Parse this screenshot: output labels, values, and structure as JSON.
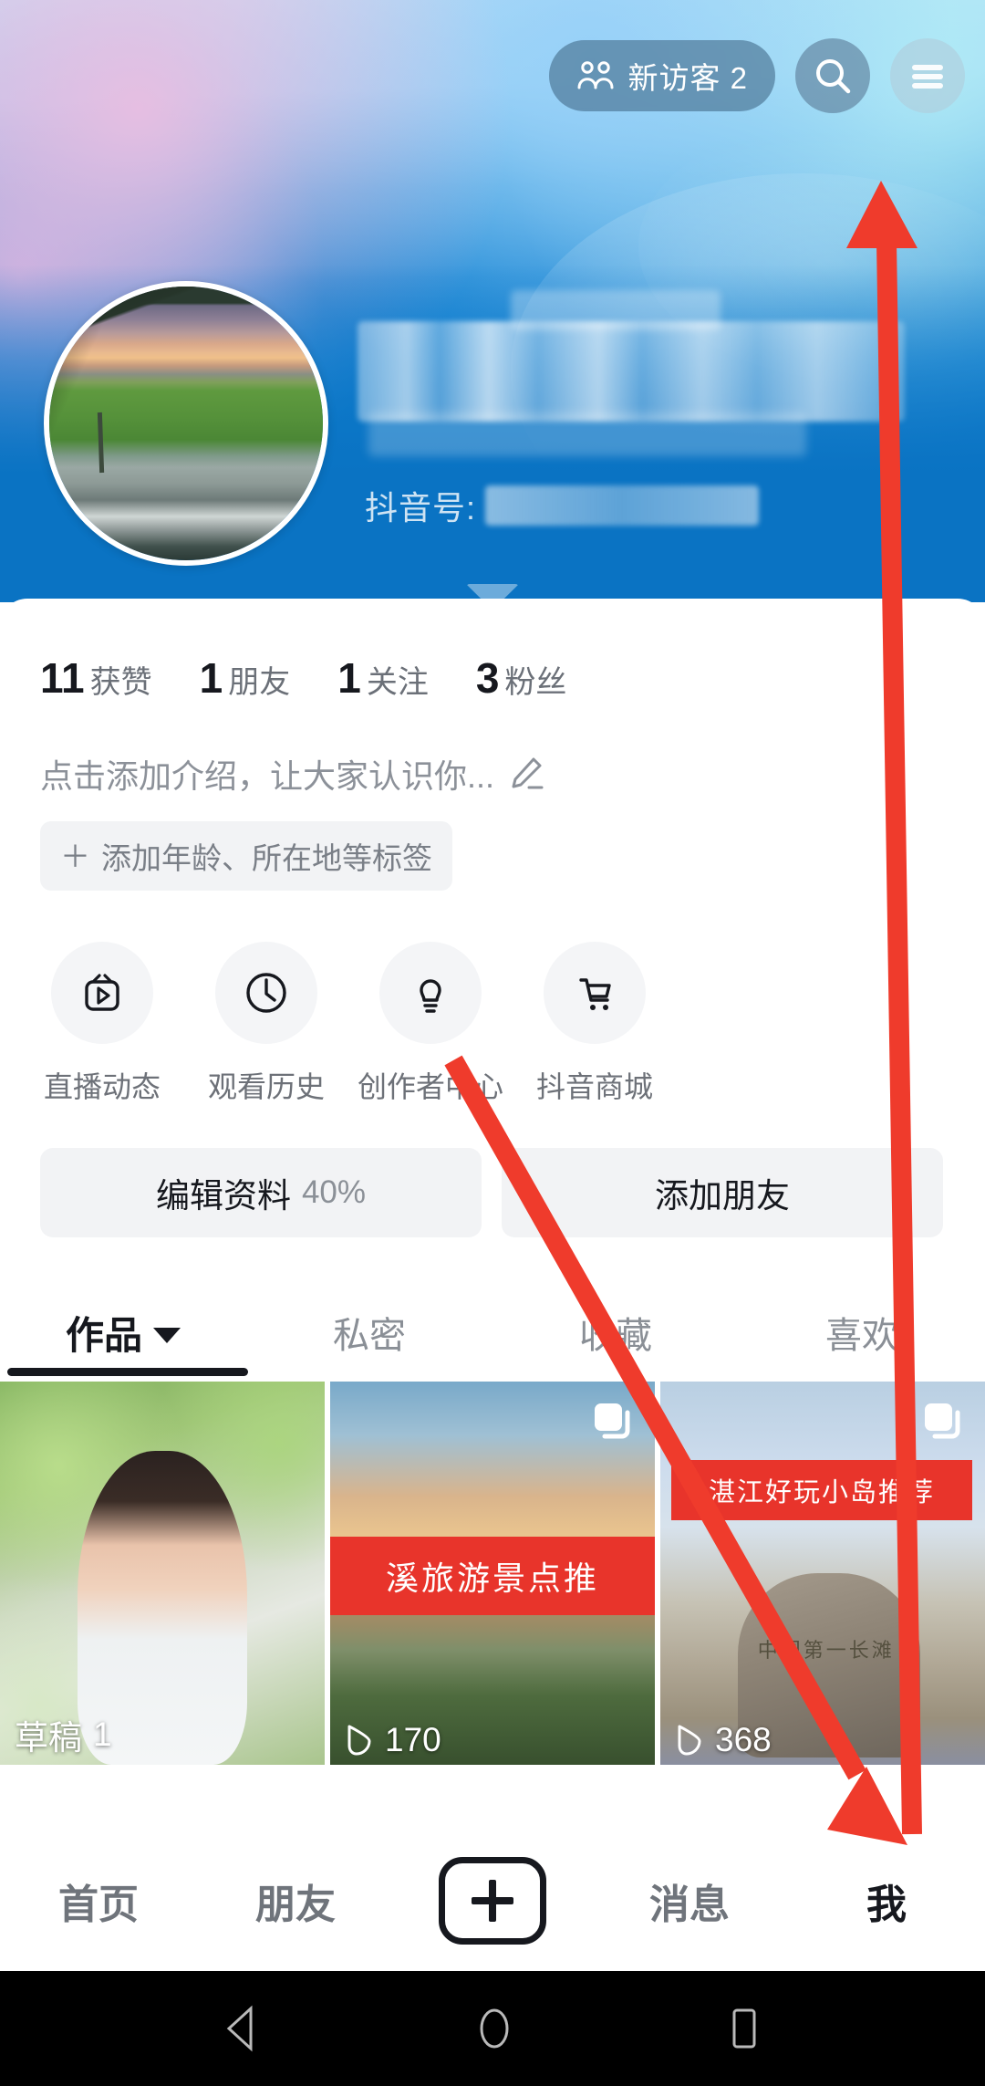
{
  "topbar": {
    "visitor_pill": {
      "label": "新访客 2",
      "icon": "visitors-icon"
    },
    "search_icon": "search-icon",
    "menu_icon": "hamburger-menu-icon"
  },
  "profile": {
    "avatar": "user-avatar",
    "display_name": "",
    "douyin_id_label": "抖音号:",
    "douyin_id_value": ""
  },
  "stats": [
    {
      "num": "11",
      "label": "获赞"
    },
    {
      "num": "1",
      "label": "朋友"
    },
    {
      "num": "1",
      "label": "关注"
    },
    {
      "num": "3",
      "label": "粉丝"
    }
  ],
  "bio": {
    "placeholder": "点击添加介绍，让大家认识你...",
    "edit_icon": "pencil-icon",
    "tag_plus": "＋",
    "tag_label": "添加年龄、所在地等标签"
  },
  "quick_actions": [
    {
      "label": "直播动态",
      "icon": "live-tv-icon"
    },
    {
      "label": "观看历史",
      "icon": "clock-history-icon"
    },
    {
      "label": "创作者中心",
      "icon": "lightbulb-icon"
    },
    {
      "label": "抖音商城",
      "icon": "shopping-cart-icon"
    }
  ],
  "actions": {
    "edit_profile_label": "编辑资料",
    "edit_profile_progress": "40%",
    "add_friend_label": "添加朋友"
  },
  "tabs": [
    {
      "label": "作品",
      "active": true,
      "has_caret": true
    },
    {
      "label": "私密",
      "active": false,
      "has_caret": false
    },
    {
      "label": "收藏",
      "active": false,
      "has_caret": false
    },
    {
      "label": "喜欢",
      "active": false,
      "has_caret": false
    }
  ],
  "grid": [
    {
      "type": "draft",
      "footer_label": "草稿",
      "footer_count": "1",
      "banner": "",
      "badge": ""
    },
    {
      "type": "video",
      "footer_label": "",
      "footer_count": "170",
      "banner": "溪旅游景点推",
      "badge": "multi-photo-icon"
    },
    {
      "type": "video",
      "footer_label": "",
      "footer_count": "368",
      "banner": "湛江好玩小岛推荐",
      "badge": "multi-photo-icon"
    }
  ],
  "bottom_nav": [
    {
      "label": "首页",
      "active": false,
      "icon": ""
    },
    {
      "label": "朋友",
      "active": false,
      "icon": ""
    },
    {
      "label": "",
      "active": false,
      "icon": "plus-create-icon"
    },
    {
      "label": "消息",
      "active": false,
      "icon": ""
    },
    {
      "label": "我",
      "active": true,
      "icon": ""
    }
  ],
  "system_nav": [
    {
      "icon": "back-triangle-icon"
    },
    {
      "icon": "home-circle-icon"
    },
    {
      "icon": "recents-square-icon"
    }
  ],
  "annotations": {
    "color": "#ef3b2c",
    "arrows": [
      {
        "name": "arrow-to-menu-button",
        "direction": "up"
      },
      {
        "name": "arrow-to-me-tab",
        "direction": "down-right"
      }
    ]
  },
  "colors": {
    "accent_red": "#ef3b2c",
    "cover_blue": "#0a73c3",
    "text_primary": "#16181e",
    "text_secondary": "#6b7078",
    "chip_bg": "#f2f3f5",
    "banner_red": "#e8342b"
  }
}
